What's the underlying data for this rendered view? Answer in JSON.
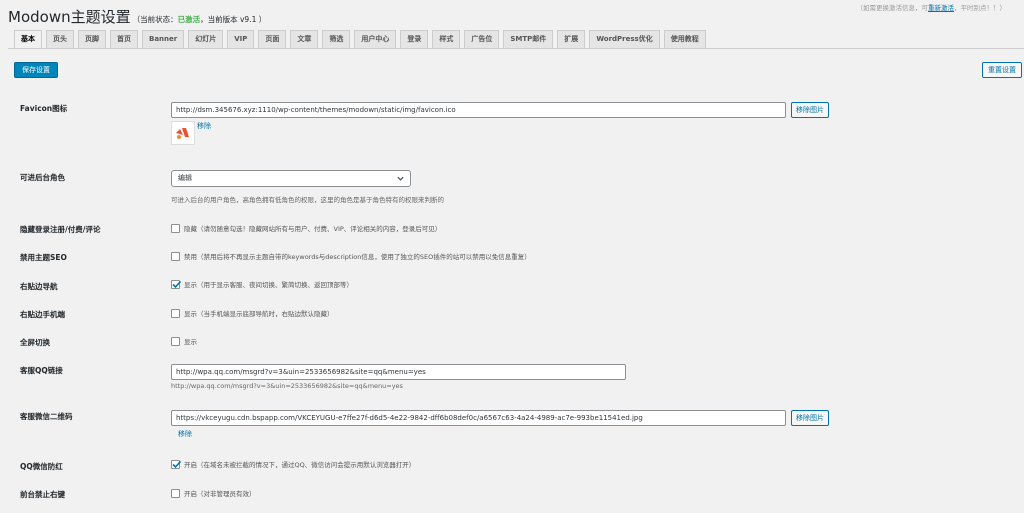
{
  "notice": {
    "text": "（如需更换激活信息，可",
    "link": "重新激活",
    "tail": "，平时别点！！）"
  },
  "header": {
    "title": "Modown主题设置",
    "status_prefix": "（当前状态：",
    "status": "已激活",
    "version": "，当前版本 v9.1 ）"
  },
  "tabs": [
    "基本",
    "页头",
    "页脚",
    "首页",
    "Banner",
    "幻灯片",
    "VIP",
    "页面",
    "文章",
    "筛选",
    "用户中心",
    "登录",
    "样式",
    "广告位",
    "SMTP邮件",
    "扩展",
    "WordPress优化",
    "使用教程"
  ],
  "toolbar": {
    "save": "保存设置",
    "reset": "重置设置"
  },
  "favicon": {
    "label": "Favicon图标",
    "value": "http://dsm.345676.xyz:1110/wp-content/themes/modown/static/img/favicon.ico",
    "button": "移除图片",
    "remove": "移除"
  },
  "backend_role": {
    "label": "可进后台角色",
    "value": "编辑",
    "desc": "可进入后台的用户角色，高角色拥有低角色的权限，这里的角色是基于角色特有的权限来判断的"
  },
  "hide_login": {
    "label": "隐藏登录注册/付费/评论",
    "checked": false,
    "text": "隐藏（请勿随意勾选！隐藏网站所有与用户、付费、VIP、评论相关的内容，登录后可见）"
  },
  "disable_seo": {
    "label": "禁用主题SEO",
    "checked": false,
    "text": "禁用（禁用后将不再显示主题自带的keywords与description信息，使用了独立的SEO插件的站可以禁用以免信息重复）"
  },
  "right_nav": {
    "label": "右贴边导航",
    "checked": true,
    "text": "显示（用于显示客服、夜间切换、繁简切换、返回顶部等）"
  },
  "right_nav_mobile": {
    "label": "右贴边手机端",
    "checked": false,
    "text": "显示（当手机端显示底部导航时，右贴边默认隐藏）"
  },
  "fullscreen": {
    "label": "全屏切换",
    "checked": false,
    "text": "显示"
  },
  "qq_link": {
    "label": "客服QQ链接",
    "value": "http://wpa.qq.com/msgrd?v=3&uin=2533656982&site=qq&menu=yes",
    "desc": "http://wpa.qq.com/msgrd?v=3&uin=2533656982&site=qq&menu=yes"
  },
  "wechat_qr": {
    "label": "客服微信二维码",
    "value": "https://vkceyugu.cdn.bspapp.com/VKCEYUGU-e7ffe27f-d6d5-4e22-9842-dff6b08def0c/a6567c63-4a24-4989-ac7e-993be11541ed.jpg",
    "button": "移除图片",
    "remove": "移除"
  },
  "qq_wechat_red": {
    "label": "QQ微信防红",
    "checked": true,
    "text": "开启（在域名未被拦截的情况下，通过QQ、微信访问会提示用默认浏览器打开）"
  },
  "disable_right_click": {
    "label": "前台禁止右键",
    "checked": false,
    "text": "开启（对非管理员有效）"
  },
  "colors": {
    "primary": "#0085ba",
    "link": "#0073aa",
    "active": "#46b450",
    "background": "#f1f1f1"
  }
}
